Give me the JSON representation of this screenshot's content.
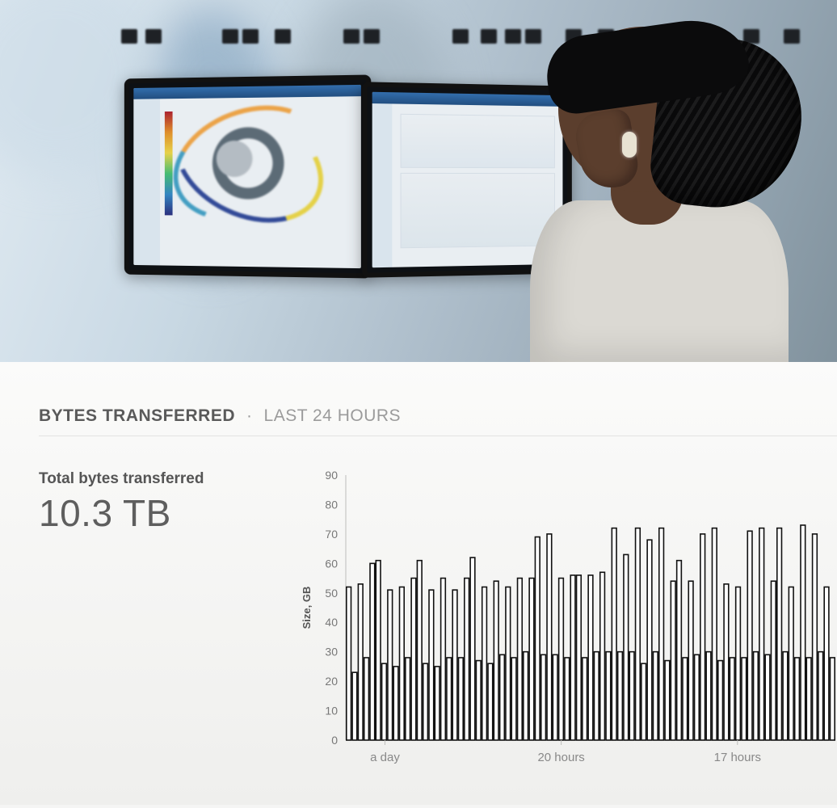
{
  "hero": {
    "description": "Photograph of an engineer in a lab viewing CAD/CFD turbine rendering on dual monitors"
  },
  "panel": {
    "title": "BYTES TRANSFERRED",
    "separator": "·",
    "range": "LAST 24 HOURS",
    "kpi_label": "Total bytes transferred",
    "kpi_value": "10.3 TB"
  },
  "chart_data": {
    "type": "bar",
    "title": "",
    "xlabel": "",
    "ylabel": "Size, GB",
    "ylim": [
      0,
      90
    ],
    "yticks": [
      0,
      10,
      20,
      30,
      40,
      50,
      60,
      70,
      80,
      90
    ],
    "x_category_labels": [
      "a day",
      "20 hours",
      "17 hours"
    ],
    "x_category_positions": [
      0.08,
      0.44,
      0.8
    ],
    "values": [
      52,
      23,
      53,
      28,
      60,
      61,
      26,
      51,
      25,
      52,
      28,
      55,
      61,
      26,
      51,
      25,
      55,
      28,
      51,
      28,
      55,
      62,
      27,
      52,
      26,
      54,
      29,
      52,
      28,
      55,
      30,
      55,
      69,
      29,
      70,
      29,
      55,
      28,
      56,
      56,
      28,
      56,
      30,
      57,
      30,
      72,
      30,
      63,
      30,
      72,
      26,
      68,
      30,
      72,
      27,
      54,
      61,
      28,
      54,
      29,
      70,
      30,
      72,
      27,
      53,
      28,
      52,
      28,
      71,
      30,
      72,
      29,
      54,
      72,
      30,
      52,
      28,
      73,
      28,
      70,
      30,
      52,
      28
    ]
  }
}
